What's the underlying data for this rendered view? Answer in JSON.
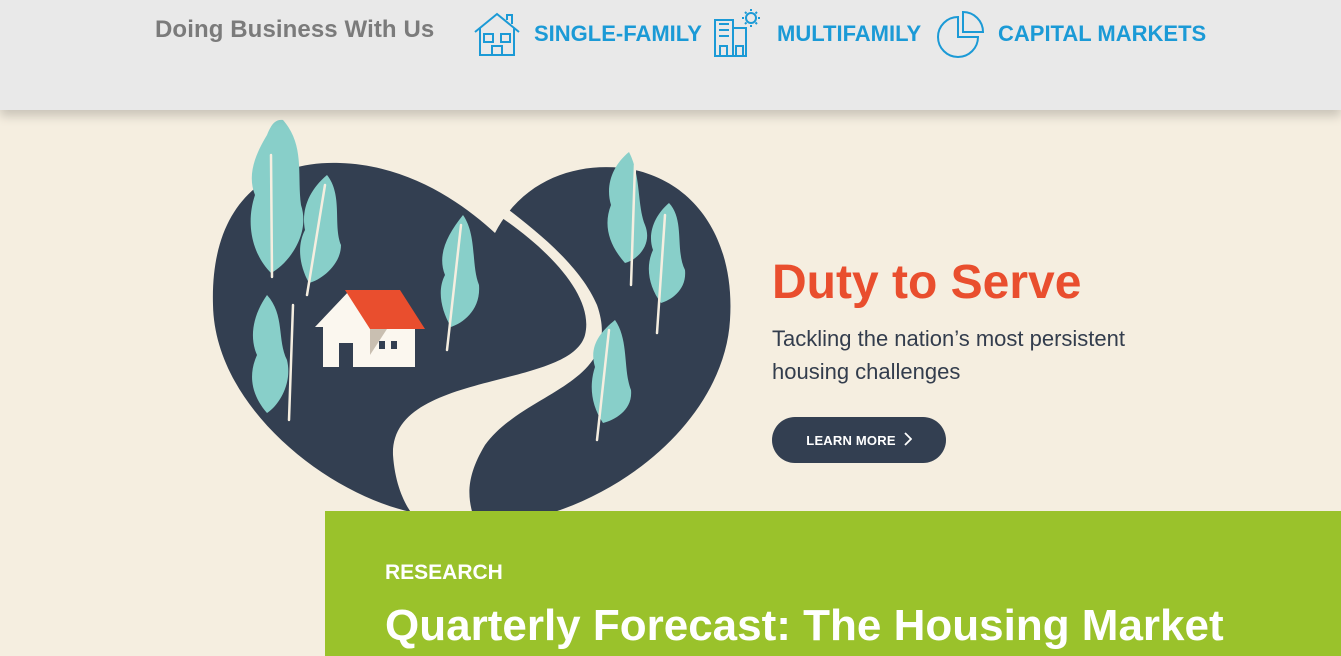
{
  "header": {
    "title": "Doing Business With Us",
    "nav": [
      {
        "label": "SINGLE-FAMILY",
        "icon": "house-icon"
      },
      {
        "label": "MULTIFAMILY",
        "icon": "building-icon"
      },
      {
        "label": "CAPITAL MARKETS",
        "icon": "pie-chart-icon"
      }
    ],
    "accent_color": "#1b9ad6"
  },
  "hero": {
    "title": "Duty to Serve",
    "subtitle": "Tackling the nation’s most persistent housing challenges",
    "button_label": "LEARN MORE",
    "illustration": "heart-landscape-house-illustration",
    "title_color": "#e94e2e",
    "button_color": "#333f51"
  },
  "feature_card": {
    "kicker": "RESEARCH",
    "title": "Quarterly Forecast: The Housing Market",
    "background_color": "#9ac22b"
  }
}
